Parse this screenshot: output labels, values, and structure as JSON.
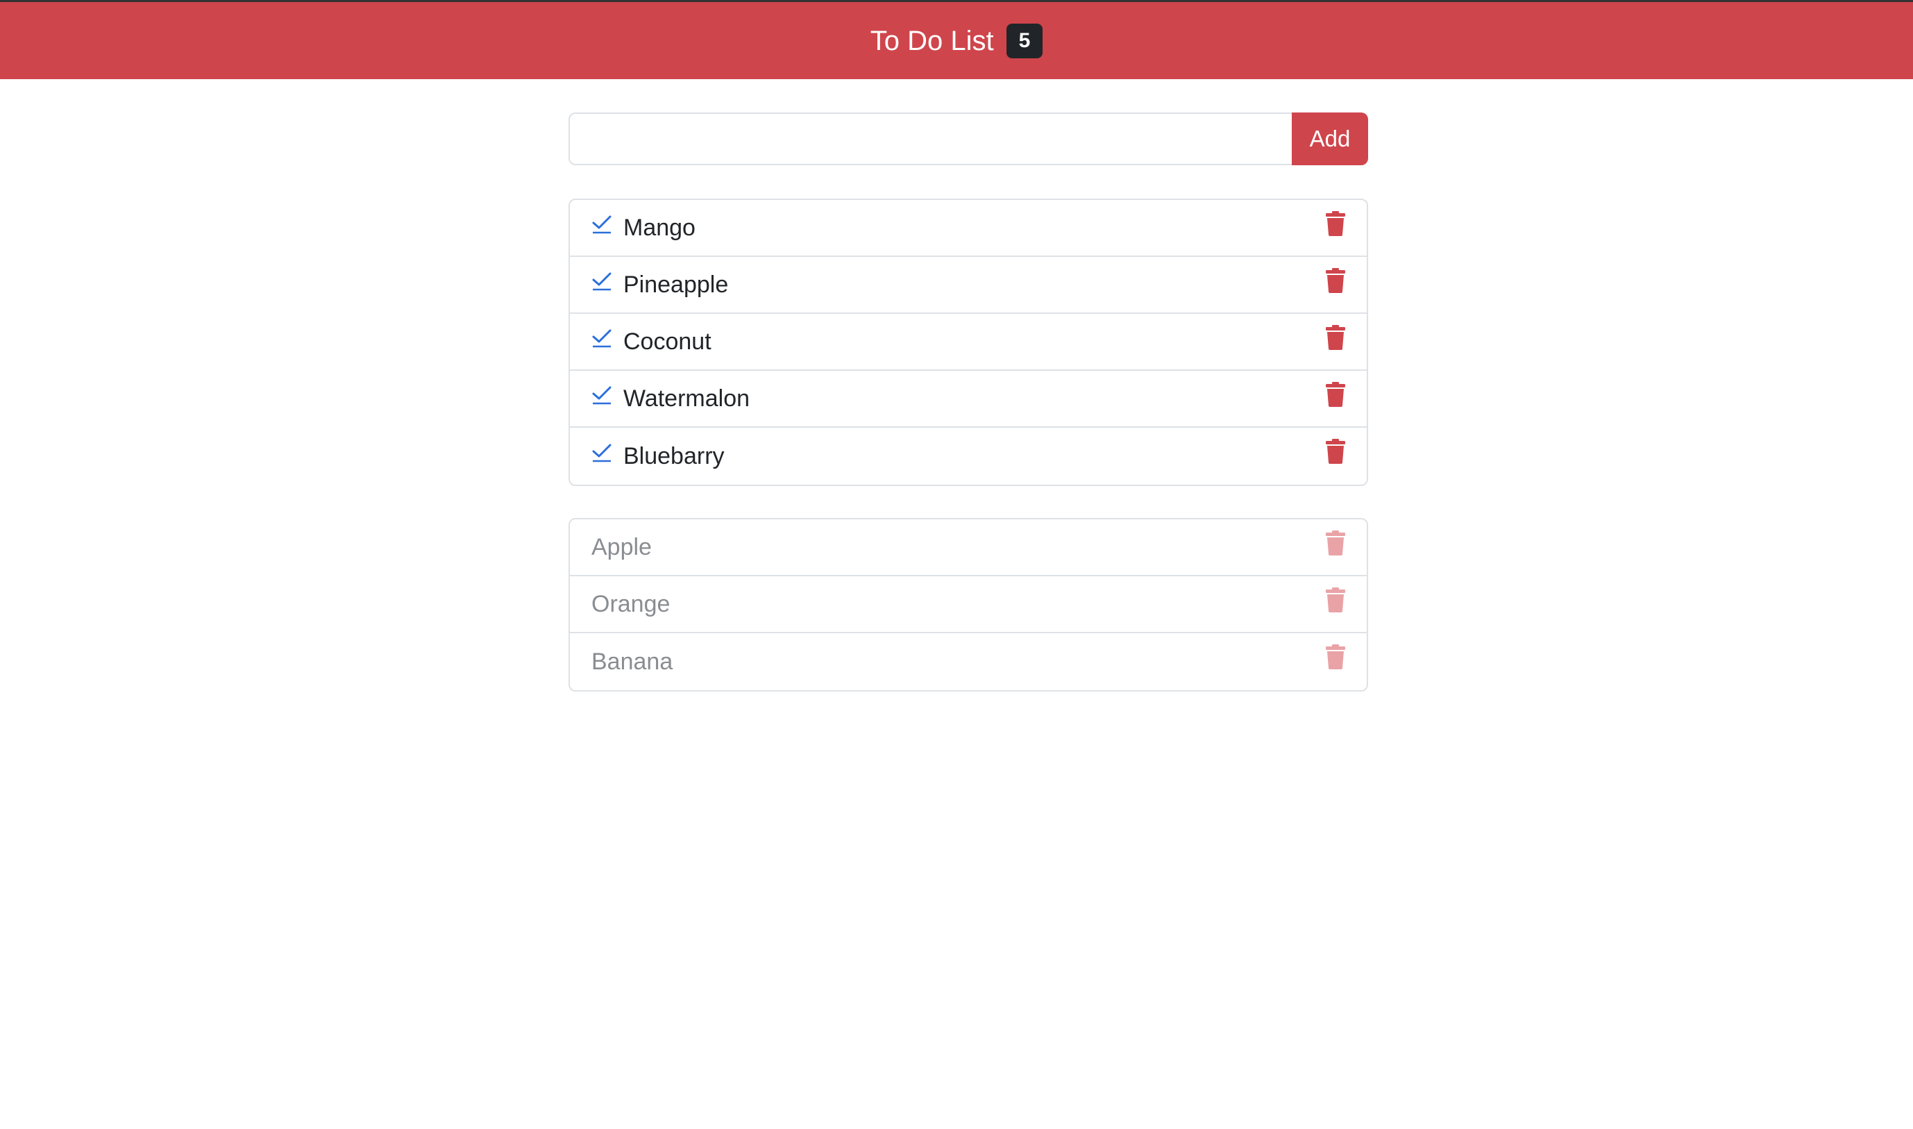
{
  "header": {
    "title": "To Do List",
    "count": "5"
  },
  "input": {
    "value": "",
    "placeholder": ""
  },
  "add_button_label": "Add",
  "active_items": [
    {
      "label": "Mango"
    },
    {
      "label": "Pineapple"
    },
    {
      "label": "Coconut"
    },
    {
      "label": "Watermalon"
    },
    {
      "label": "Bluebarry"
    }
  ],
  "completed_items": [
    {
      "label": "Apple"
    },
    {
      "label": "Orange"
    },
    {
      "label": "Banana"
    }
  ],
  "colors": {
    "accent": "#cf454c",
    "badge": "#212529",
    "check": "#2a6fdb",
    "trash_active": "#cf454c",
    "trash_done": "#e9a3a7"
  },
  "icons": {
    "complete": "check-icon",
    "delete": "trash-icon"
  }
}
